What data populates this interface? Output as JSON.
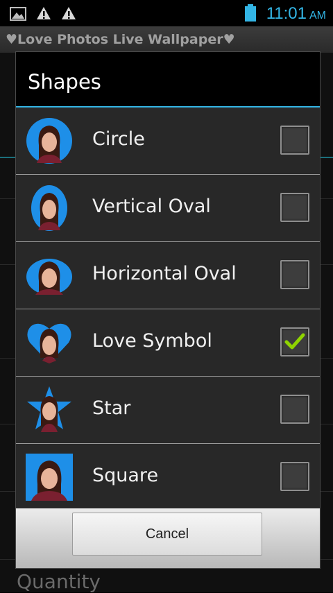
{
  "status_bar": {
    "time": "11:01",
    "ampm": "AM",
    "icons": [
      "image-icon",
      "warning-icon",
      "warning-icon",
      "battery-icon"
    ],
    "accent": "#33b5e5"
  },
  "app_title": "Love Photos Live Wallpaper",
  "background": {
    "visible_label": "Quantity"
  },
  "dialog": {
    "title": "Shapes",
    "options": [
      {
        "label": "Circle",
        "shape": "circle",
        "checked": false
      },
      {
        "label": "Vertical Oval",
        "shape": "vertical-oval",
        "checked": false
      },
      {
        "label": "Horizontal Oval",
        "shape": "horizontal-oval",
        "checked": false
      },
      {
        "label": "Love Symbol",
        "shape": "heart",
        "checked": true
      },
      {
        "label": "Star",
        "shape": "star",
        "checked": false
      },
      {
        "label": "Square",
        "shape": "square",
        "checked": false
      }
    ],
    "cancel_label": "Cancel",
    "check_color": "#8fd400",
    "shape_color": "#1e8fe8"
  }
}
